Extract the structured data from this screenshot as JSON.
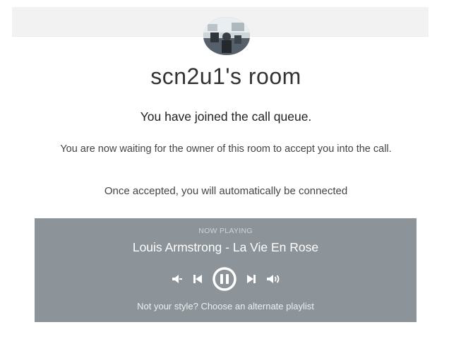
{
  "room": {
    "title": "scn2u1's room"
  },
  "queue": {
    "heading": "You have joined the call queue.",
    "waiting_message": "You are now waiting for the owner of this room to accept you into the call.",
    "accepted_message": "Once accepted, you will automatically be connected"
  },
  "player": {
    "now_playing_label": "NOW PLAYING",
    "track": "Louis Armstrong - La Vie En Rose",
    "alternate_playlist_link": "Not your style? Choose an alternate playlist",
    "background_color": "#8c9499",
    "icons": [
      "volume-down-icon",
      "previous-track-icon",
      "pause-icon",
      "next-track-icon",
      "volume-up-icon"
    ]
  }
}
